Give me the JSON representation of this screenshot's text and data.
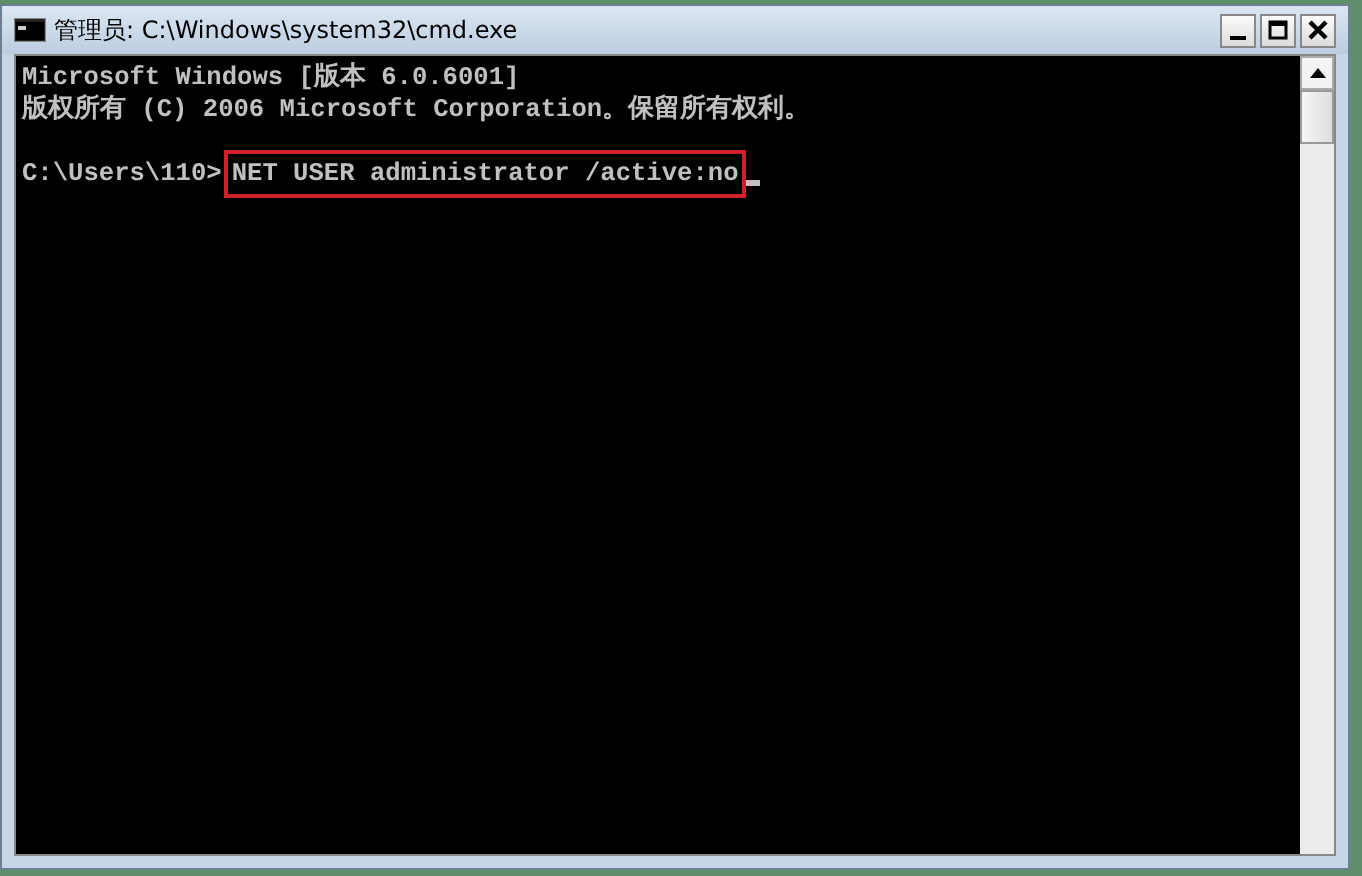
{
  "window": {
    "title": "管理员: C:\\Windows\\system32\\cmd.exe"
  },
  "console": {
    "lines": [
      {
        "kind": "output",
        "text": "Microsoft Windows [版本 6.0.6001]"
      },
      {
        "kind": "output",
        "text": "版权所有 (C) 2006 Microsoft Corporation。保留所有权利。"
      },
      {
        "kind": "blank"
      },
      {
        "kind": "command",
        "prompt": "C:\\Users\\110>",
        "command": "NET USER administrator /active:no",
        "highlighted": true,
        "cursor": true
      }
    ]
  }
}
